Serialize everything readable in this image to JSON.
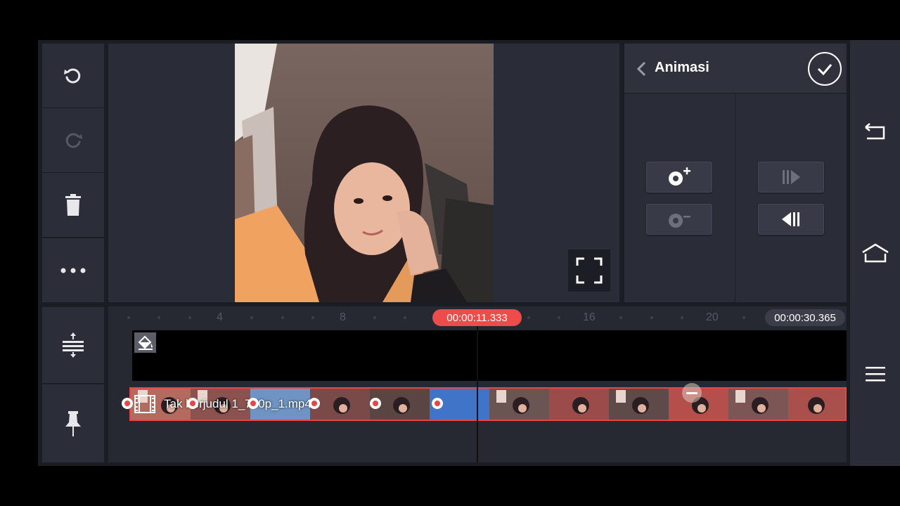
{
  "tools": {
    "undo": "undo-icon",
    "redo": "redo-icon",
    "delete": "trash-icon",
    "more": "more-icon",
    "layer_adjust": "align-center-icon",
    "pin": "pin-icon"
  },
  "animation_panel": {
    "title": "Animasi",
    "add_keyframe": "add-keyframe-icon",
    "remove_keyframe": "remove-keyframe-icon",
    "next_keyframe": "next-keyframe-icon",
    "prev_keyframe": "prev-keyframe-icon"
  },
  "timeline": {
    "ruler_labels": [
      "4",
      "8",
      "16",
      "20"
    ],
    "current_time": "00:00:11.333",
    "total_time": "00:00:30.365",
    "clip_name": "Tak berjudul 1_720p_1.mp4"
  },
  "colors": {
    "accent": "#ee4b4b",
    "panel": "#2a2d37",
    "background": "#1b1d24"
  }
}
